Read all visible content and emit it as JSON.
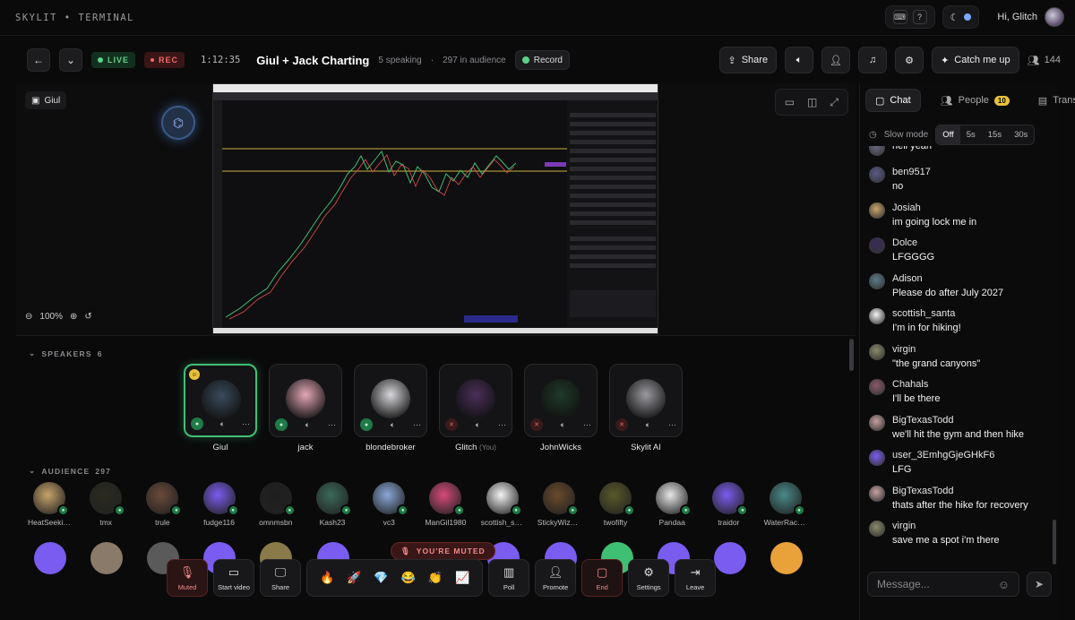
{
  "app": {
    "brand": "SKYLIT • TERMINAL",
    "greeting": "Hi, Glitch"
  },
  "header": {
    "live": "LIVE",
    "rec": "REC",
    "timer": "1:12:35",
    "title": "Giul + Jack Charting",
    "speaking": "5 speaking",
    "sep": "·",
    "audience": "297 in audience",
    "record": "Record",
    "share": "Share",
    "catch_up": "Catch me up",
    "listeners": "144"
  },
  "stage": {
    "speaker_tag": "Giul",
    "zoom": "100%"
  },
  "speakers": {
    "label": "SPEAKERS",
    "count": "6",
    "items": [
      {
        "name": "Giul",
        "mic": "on",
        "active": true,
        "color": "#3a4b5c"
      },
      {
        "name": "jack",
        "mic": "on",
        "active": false,
        "color": "#e4a7b7"
      },
      {
        "name": "blondebroker",
        "mic": "on",
        "active": false,
        "color": "#d8d8dc"
      },
      {
        "name": "Glitch",
        "you": "(You)",
        "mic": "off",
        "active": false,
        "color": "#4b2f5a"
      },
      {
        "name": "JohnWicks",
        "mic": "off",
        "active": false,
        "color": "#1f3a2a"
      },
      {
        "name": "Skylit AI",
        "mic": "off",
        "active": false,
        "color": "#9a9aa0"
      }
    ]
  },
  "audience": {
    "label": "AUDIENCE",
    "count": "297",
    "items": [
      {
        "name": "HeatSeekin...",
        "color": "#c9a46a"
      },
      {
        "name": "tmx",
        "color": "#2a2a1e"
      },
      {
        "name": "trule",
        "color": "#6a4a3a"
      },
      {
        "name": "fudge116",
        "color": "#7b5cf0"
      },
      {
        "name": "omnmsbn",
        "color": "#1e1e1e"
      },
      {
        "name": "Kash23",
        "color": "#3a6a5a"
      },
      {
        "name": "vc3",
        "color": "#8aa8d8"
      },
      {
        "name": "ManGil1980",
        "color": "#d84a7a"
      },
      {
        "name": "scottish_sa...",
        "color": "#f4f4f4"
      },
      {
        "name": "StickyWizard",
        "color": "#6a4a2a"
      },
      {
        "name": "twofifty",
        "color": "#5a5a2a"
      },
      {
        "name": "Pandaa",
        "color": "#e8e8e8"
      },
      {
        "name": "traidor",
        "color": "#7b5cf0"
      },
      {
        "name": "WaterRacc...",
        "color": "#4a8a8a"
      }
    ]
  },
  "banner": {
    "muted": "YOU'RE MUTED"
  },
  "dock": {
    "muted": "Muted",
    "start_video": "Start video",
    "share": "Share",
    "poll": "Poll",
    "promote": "Promote",
    "end": "End",
    "settings": "Settings",
    "leave": "Leave"
  },
  "panel": {
    "tab_chat": "Chat",
    "tab_people": "People",
    "people_count": "10",
    "tab_transcript": "Transcri",
    "slow_mode": "Slow mode",
    "slow_opts": [
      "Off",
      "5s",
      "15s",
      "30s"
    ],
    "messages": [
      {
        "user": "",
        "text": "hell yeah",
        "color": "#6a6a80"
      },
      {
        "user": "ben9517",
        "text": "no",
        "color": "#5a5a8a"
      },
      {
        "user": "Josiah",
        "text": "im going lock me in",
        "color": "#c9a46a"
      },
      {
        "user": "Dolce",
        "text": "LFGGGG",
        "color": "#3a2a5a"
      },
      {
        "user": "Adison",
        "text": "Please do after July 2027",
        "color": "#5a7a8a"
      },
      {
        "user": "scottish_santa",
        "text": "I'm in for hiking!",
        "color": "#f4f4f4"
      },
      {
        "user": "virgin",
        "text": "\"the grand canyons\"",
        "color": "#8a8a6a"
      },
      {
        "user": "Chahals",
        "text": "I'll be there",
        "color": "#8a5a6a"
      },
      {
        "user": "BigTexasTodd",
        "text": "we'll hit the gym and then hike",
        "color": "#c8a0a0"
      },
      {
        "user": "user_3EmhgGjeGHkF6",
        "text": "LFG",
        "color": "#7b5cf0"
      },
      {
        "user": "BigTexasTodd",
        "text": "thats after the hike for recovery",
        "color": "#c8a0a0"
      },
      {
        "user": "virgin",
        "text": "save me a spot i'm there",
        "color": "#8a8a6a"
      }
    ],
    "placeholder": "Message..."
  }
}
